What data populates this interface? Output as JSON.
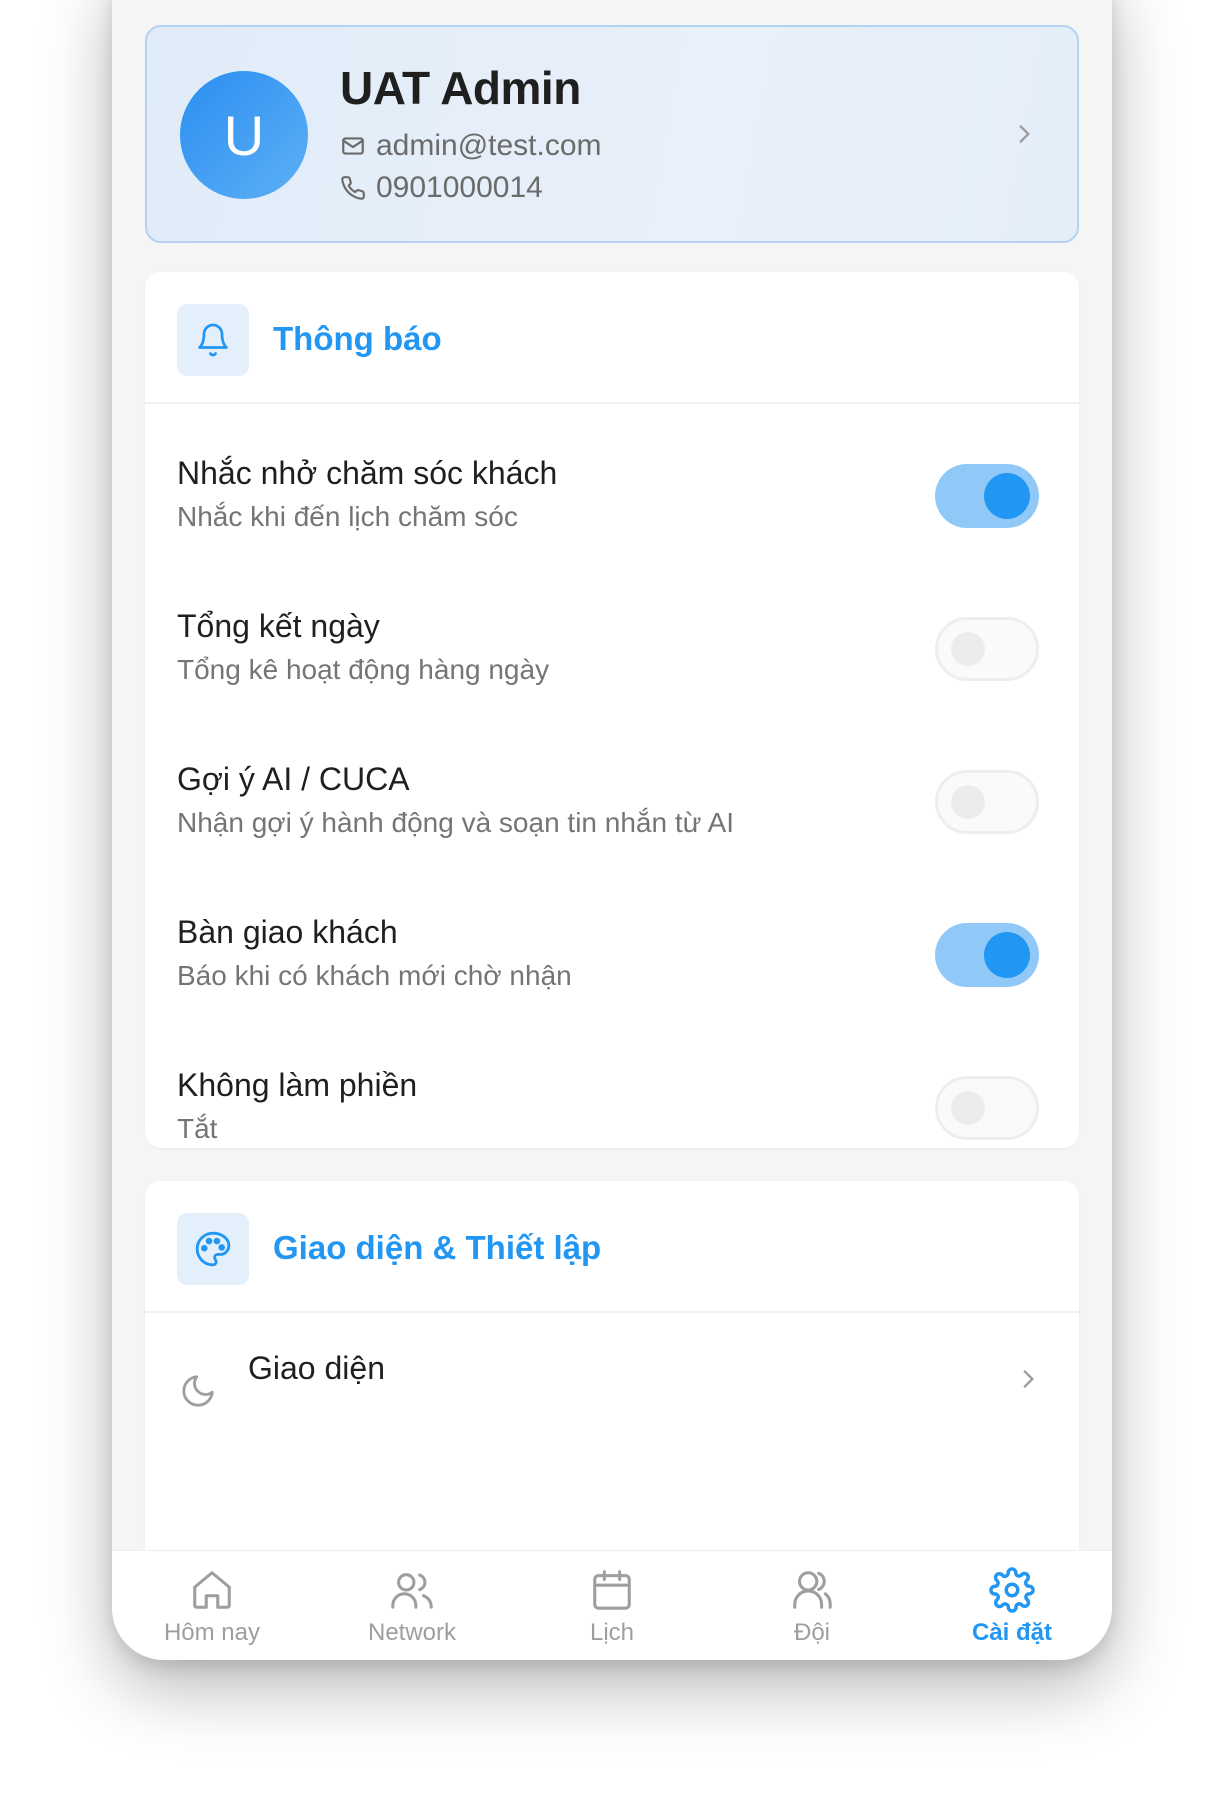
{
  "profile": {
    "initial": "U",
    "name": "UAT Admin",
    "email": "admin@test.com",
    "phone": "0901000014"
  },
  "notifications": {
    "title": "Thông báo",
    "icon": "bell-icon",
    "items": [
      {
        "title": "Nhắc nhở chăm sóc khách",
        "subtitle": "Nhắc khi đến lịch chăm sóc",
        "enabled": true
      },
      {
        "title": "Tổng kết ngày",
        "subtitle": "Tổng kê hoạt động hàng ngày",
        "enabled": false
      },
      {
        "title": "Gợi ý AI / CUCA",
        "subtitle": "Nhận gợi ý hành động và soạn tin nhắn từ AI",
        "enabled": false
      },
      {
        "title": "Bàn giao khách",
        "subtitle": "Báo khi có khách mới chờ nhận",
        "enabled": true
      },
      {
        "title": "Không làm phiền",
        "subtitle": "Tắt",
        "enabled": false
      }
    ]
  },
  "appearance": {
    "title": "Giao diện & Thiết lập",
    "icon": "palette-icon",
    "items": [
      {
        "title": "Giao diện",
        "icon": "moon-icon"
      }
    ]
  },
  "tabs": [
    {
      "label": "Hôm nay",
      "icon": "home-icon",
      "active": false
    },
    {
      "label": "Network",
      "icon": "users-icon",
      "active": false
    },
    {
      "label": "Lịch",
      "icon": "calendar-icon",
      "active": false
    },
    {
      "label": "Đội",
      "icon": "team-icon",
      "active": false
    },
    {
      "label": "Cài đặt",
      "icon": "gear-icon",
      "active": true
    }
  ],
  "colors": {
    "accent": "#2196f3",
    "toggle_on_track": "#90c9f8"
  }
}
